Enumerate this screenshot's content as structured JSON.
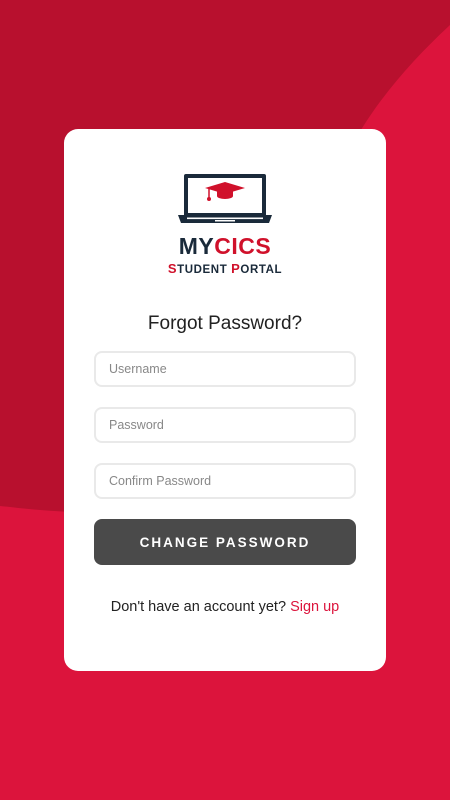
{
  "colors": {
    "accent": "#dc143c",
    "background_dark": "#b8102e",
    "button": "#4a4a4a",
    "logo_dark": "#1a2a3a"
  },
  "logo": {
    "icon": "laptop-graduation-cap-icon",
    "title_part1": "MY",
    "title_part2": "CICS",
    "subtitle_s": "S",
    "subtitle_1": "TUDENT ",
    "subtitle_p": "P",
    "subtitle_2": "ORTAL"
  },
  "form": {
    "title": "Forgot Password?",
    "username_placeholder": "Username",
    "password_placeholder": "Password",
    "confirm_placeholder": "Confirm Password",
    "submit_label": "CHANGE PASSWORD"
  },
  "footer": {
    "prompt": "Don't have an account yet?",
    "signup_link": "Sign up"
  }
}
